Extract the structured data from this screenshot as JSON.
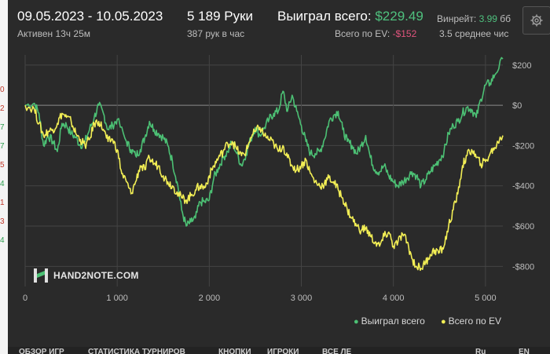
{
  "header": {
    "date_range": "09.05.2023 - 10.05.2023",
    "hands": "5 189 Руки",
    "won_total_label": "Выиграл всего:",
    "won_total_value": "$229.49",
    "winrate_label": "Винрейт:",
    "winrate_value": "3.99",
    "winrate_unit": "бб",
    "active_time": "Активен 13ч 25м",
    "hands_per_hour": "387 рук в час",
    "ev_total_label": "Всего по EV:",
    "ev_total_value": "-$152",
    "avg_stack": "3.5 среднее чис"
  },
  "logo": {
    "text": "HAND2NOTE.COM"
  },
  "left_strip": [
    {
      "text": "0",
      "color": "#c0392b"
    },
    {
      "text": "2",
      "color": "#c0392b"
    },
    {
      "text": "7",
      "color": "#2e9e50"
    },
    {
      "text": "7",
      "color": "#2e9e50"
    },
    {
      "text": "5",
      "color": "#c0392b"
    },
    {
      "text": "4",
      "color": "#2e9e50"
    },
    {
      "text": "1",
      "color": "#c0392b"
    },
    {
      "text": "3",
      "color": "#c0392b"
    },
    {
      "text": "4",
      "color": "#2e9e50"
    }
  ],
  "bottom_tabs": [
    "ОБЗОР ИГР",
    "СТАТИСТИКА ТУРНИРОВ",
    "КНОПКИ",
    "ИГРОКИ",
    "ВСЕ ЛЕ",
    "Ru",
    "EN"
  ],
  "colors": {
    "won": "#4cc074",
    "ev": "#f2ee55",
    "grid": "#444444",
    "zero": "#8a8a8a"
  },
  "chart_data": {
    "type": "line",
    "xlim": [
      0,
      5189
    ],
    "ylim": [
      -900,
      250
    ],
    "x_ticks": [
      0,
      1000,
      2000,
      3000,
      4000,
      5000
    ],
    "x_tick_labels": [
      "0",
      "1 000",
      "2 000",
      "3 000",
      "4 000",
      "5 000"
    ],
    "y_ticks": [
      200,
      0,
      -200,
      -400,
      -600,
      -800
    ],
    "y_tick_labels": [
      "$200",
      "$0",
      "-$200",
      "-$400",
      "-$600",
      "-$800"
    ],
    "series": [
      {
        "name": "Выиграл всего",
        "color": "#4cc074",
        "points": [
          [
            0,
            0
          ],
          [
            100,
            10
          ],
          [
            150,
            -40
          ],
          [
            200,
            -200
          ],
          [
            250,
            -150
          ],
          [
            300,
            -180
          ],
          [
            350,
            -230
          ],
          [
            400,
            -90
          ],
          [
            450,
            -100
          ],
          [
            500,
            -140
          ],
          [
            550,
            -160
          ],
          [
            600,
            -200
          ],
          [
            650,
            -180
          ],
          [
            700,
            -120
          ],
          [
            750,
            -60
          ],
          [
            800,
            0
          ],
          [
            850,
            -40
          ],
          [
            900,
            -120
          ],
          [
            950,
            -100
          ],
          [
            1000,
            -70
          ],
          [
            1100,
            -180
          ],
          [
            1150,
            -220
          ],
          [
            1200,
            -250
          ],
          [
            1250,
            -220
          ],
          [
            1300,
            -160
          ],
          [
            1350,
            -80
          ],
          [
            1400,
            -120
          ],
          [
            1450,
            -140
          ],
          [
            1500,
            -160
          ],
          [
            1550,
            -200
          ],
          [
            1600,
            -280
          ],
          [
            1650,
            -380
          ],
          [
            1700,
            -520
          ],
          [
            1750,
            -600
          ],
          [
            1800,
            -580
          ],
          [
            1850,
            -560
          ],
          [
            1900,
            -480
          ],
          [
            1950,
            -480
          ],
          [
            2000,
            -470
          ],
          [
            2050,
            -360
          ],
          [
            2100,
            -310
          ],
          [
            2150,
            -260
          ],
          [
            2200,
            -230
          ],
          [
            2250,
            -180
          ],
          [
            2300,
            -240
          ],
          [
            2350,
            -300
          ],
          [
            2400,
            -240
          ],
          [
            2450,
            -170
          ],
          [
            2500,
            -110
          ],
          [
            2550,
            -150
          ],
          [
            2600,
            -110
          ],
          [
            2650,
            -70
          ],
          [
            2700,
            -40
          ],
          [
            2750,
            -30
          ],
          [
            2800,
            70
          ],
          [
            2850,
            -30
          ],
          [
            2900,
            50
          ],
          [
            2950,
            -30
          ],
          [
            3000,
            -100
          ],
          [
            3050,
            -180
          ],
          [
            3100,
            -240
          ],
          [
            3150,
            -240
          ],
          [
            3200,
            -230
          ],
          [
            3250,
            -170
          ],
          [
            3300,
            -80
          ],
          [
            3350,
            -50
          ],
          [
            3400,
            -30
          ],
          [
            3450,
            -120
          ],
          [
            3500,
            -180
          ],
          [
            3550,
            -200
          ],
          [
            3600,
            -240
          ],
          [
            3650,
            -200
          ],
          [
            3700,
            -150
          ],
          [
            3750,
            -260
          ],
          [
            3800,
            -320
          ],
          [
            3850,
            -330
          ],
          [
            3900,
            -300
          ],
          [
            3950,
            -350
          ],
          [
            4000,
            -380
          ],
          [
            4050,
            -400
          ],
          [
            4100,
            -380
          ],
          [
            4150,
            -360
          ],
          [
            4200,
            -330
          ],
          [
            4250,
            -350
          ],
          [
            4300,
            -400
          ],
          [
            4350,
            -370
          ],
          [
            4400,
            -330
          ],
          [
            4450,
            -300
          ],
          [
            4500,
            -270
          ],
          [
            4550,
            -230
          ],
          [
            4600,
            -140
          ],
          [
            4650,
            -100
          ],
          [
            4700,
            -80
          ],
          [
            4750,
            -40
          ],
          [
            4800,
            -10
          ],
          [
            4850,
            -20
          ],
          [
            4900,
            -60
          ],
          [
            4950,
            30
          ],
          [
            5000,
            100
          ],
          [
            5050,
            110
          ],
          [
            5100,
            150
          ],
          [
            5189,
            230
          ]
        ]
      },
      {
        "name": "Всего по EV",
        "color": "#f2ee55",
        "points": [
          [
            0,
            0
          ],
          [
            100,
            -20
          ],
          [
            150,
            -90
          ],
          [
            200,
            -150
          ],
          [
            250,
            -130
          ],
          [
            300,
            -120
          ],
          [
            350,
            -90
          ],
          [
            400,
            -40
          ],
          [
            450,
            -60
          ],
          [
            500,
            -80
          ],
          [
            550,
            -140
          ],
          [
            600,
            -170
          ],
          [
            650,
            -200
          ],
          [
            700,
            -170
          ],
          [
            750,
            -90
          ],
          [
            800,
            -80
          ],
          [
            850,
            -120
          ],
          [
            900,
            -180
          ],
          [
            950,
            -170
          ],
          [
            1000,
            -220
          ],
          [
            1050,
            -340
          ],
          [
            1100,
            -380
          ],
          [
            1150,
            -440
          ],
          [
            1200,
            -380
          ],
          [
            1250,
            -300
          ],
          [
            1300,
            -320
          ],
          [
            1350,
            -260
          ],
          [
            1400,
            -290
          ],
          [
            1450,
            -300
          ],
          [
            1500,
            -350
          ],
          [
            1550,
            -380
          ],
          [
            1600,
            -400
          ],
          [
            1650,
            -430
          ],
          [
            1700,
            -460
          ],
          [
            1750,
            -470
          ],
          [
            1800,
            -450
          ],
          [
            1850,
            -420
          ],
          [
            1900,
            -400
          ],
          [
            1950,
            -410
          ],
          [
            2000,
            -350
          ],
          [
            2050,
            -300
          ],
          [
            2100,
            -260
          ],
          [
            2150,
            -230
          ],
          [
            2200,
            -190
          ],
          [
            2250,
            -180
          ],
          [
            2300,
            -220
          ],
          [
            2350,
            -250
          ],
          [
            2400,
            -230
          ],
          [
            2450,
            -160
          ],
          [
            2500,
            -130
          ],
          [
            2550,
            -110
          ],
          [
            2600,
            -150
          ],
          [
            2650,
            -170
          ],
          [
            2700,
            -190
          ],
          [
            2750,
            -230
          ],
          [
            2800,
            -200
          ],
          [
            2850,
            -260
          ],
          [
            2900,
            -300
          ],
          [
            2950,
            -320
          ],
          [
            3000,
            -300
          ],
          [
            3050,
            -270
          ],
          [
            3100,
            -340
          ],
          [
            3150,
            -380
          ],
          [
            3200,
            -400
          ],
          [
            3250,
            -390
          ],
          [
            3300,
            -360
          ],
          [
            3350,
            -380
          ],
          [
            3400,
            -420
          ],
          [
            3450,
            -460
          ],
          [
            3500,
            -520
          ],
          [
            3550,
            -560
          ],
          [
            3600,
            -600
          ],
          [
            3650,
            -620
          ],
          [
            3700,
            -610
          ],
          [
            3750,
            -650
          ],
          [
            3800,
            -680
          ],
          [
            3850,
            -700
          ],
          [
            3900,
            -650
          ],
          [
            3950,
            -630
          ],
          [
            4000,
            -700
          ],
          [
            4050,
            -680
          ],
          [
            4100,
            -640
          ],
          [
            4150,
            -680
          ],
          [
            4200,
            -760
          ],
          [
            4250,
            -800
          ],
          [
            4300,
            -810
          ],
          [
            4350,
            -780
          ],
          [
            4400,
            -740
          ],
          [
            4450,
            -720
          ],
          [
            4500,
            -730
          ],
          [
            4550,
            -700
          ],
          [
            4600,
            -600
          ],
          [
            4650,
            -520
          ],
          [
            4700,
            -440
          ],
          [
            4750,
            -300
          ],
          [
            4800,
            -250
          ],
          [
            4850,
            -220
          ],
          [
            4900,
            -260
          ],
          [
            4950,
            -290
          ],
          [
            5000,
            -280
          ],
          [
            5050,
            -240
          ],
          [
            5100,
            -210
          ],
          [
            5189,
            -150
          ]
        ]
      }
    ]
  }
}
